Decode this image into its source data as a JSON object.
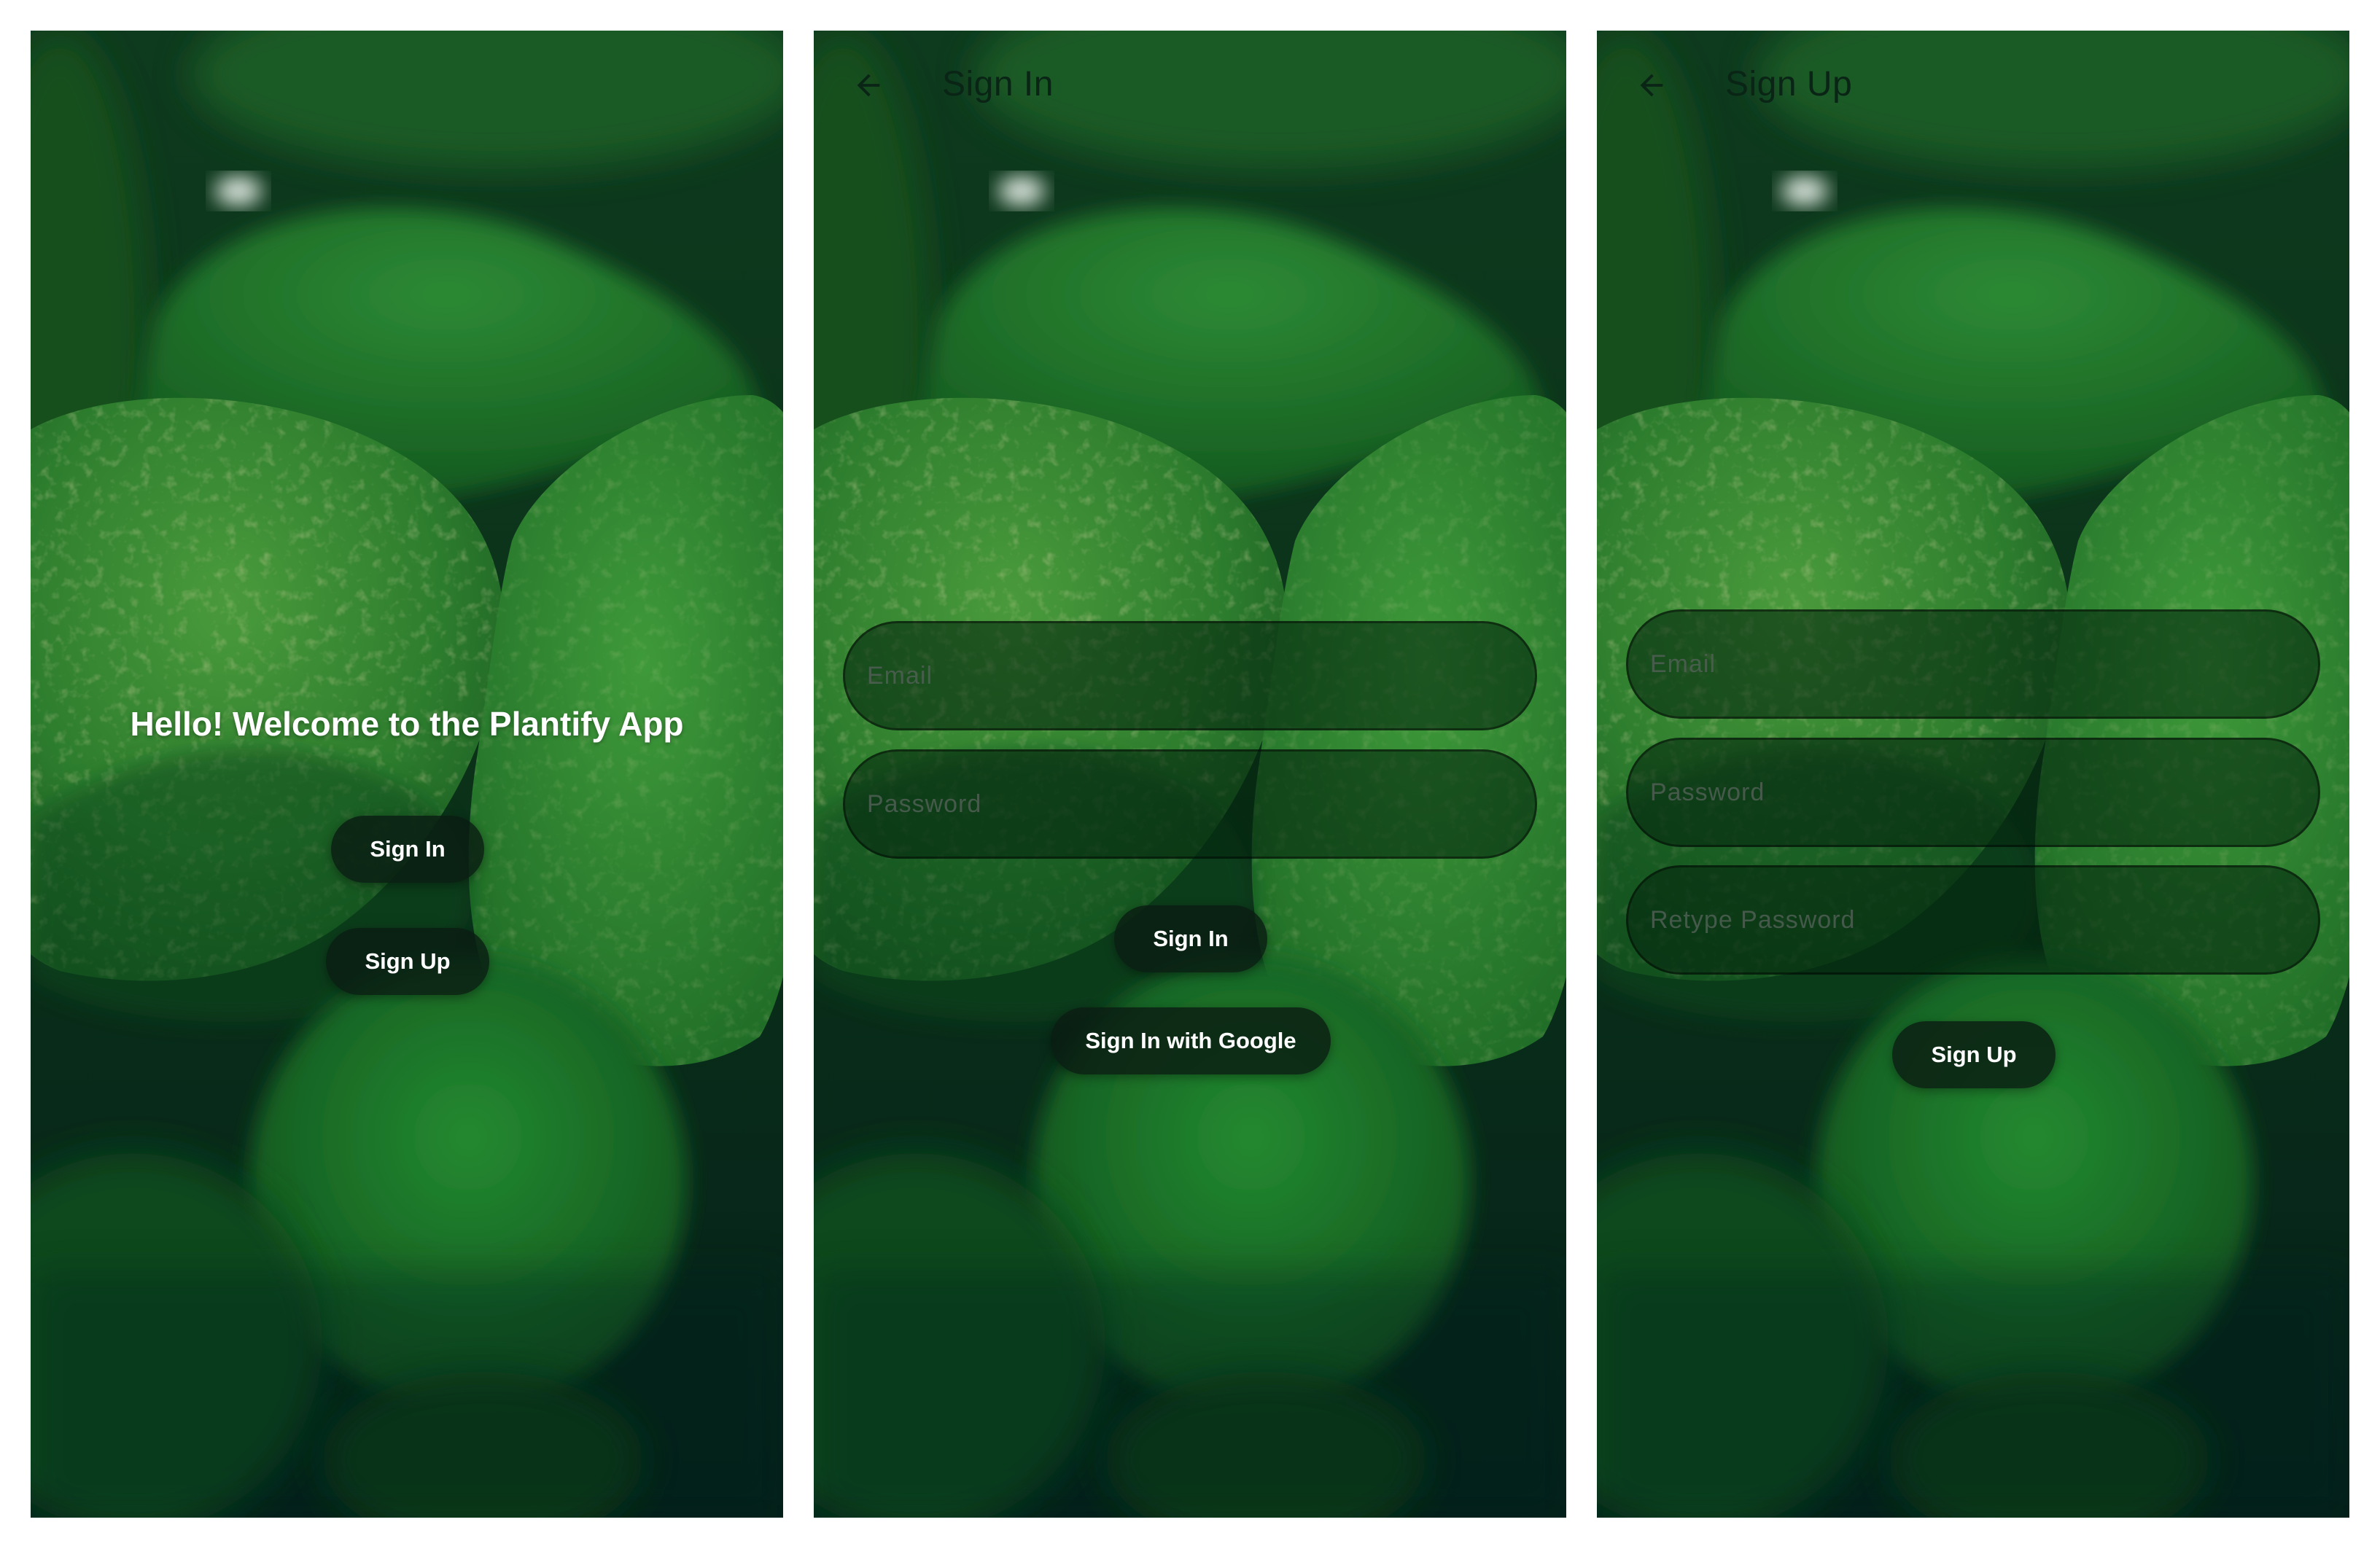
{
  "welcome": {
    "title": "Hello! Welcome to the Plantify App",
    "sign_in_label": "Sign In",
    "sign_up_label": "Sign Up"
  },
  "sign_in": {
    "app_bar_title": "Sign In",
    "back_icon": "arrow-back-icon",
    "email_placeholder": "Email",
    "password_placeholder": "Password",
    "sign_in_label": "Sign In",
    "google_label": "Sign In with Google"
  },
  "sign_up": {
    "app_bar_title": "Sign Up",
    "back_icon": "arrow-back-icon",
    "email_placeholder": "Email",
    "password_placeholder": "Password",
    "retype_placeholder": "Retype Password",
    "sign_up_label": "Sign Up"
  },
  "colors": {
    "button_bg": "#0a1c12",
    "background_dark": "#062418",
    "leaf_green": "#2f8a36"
  }
}
